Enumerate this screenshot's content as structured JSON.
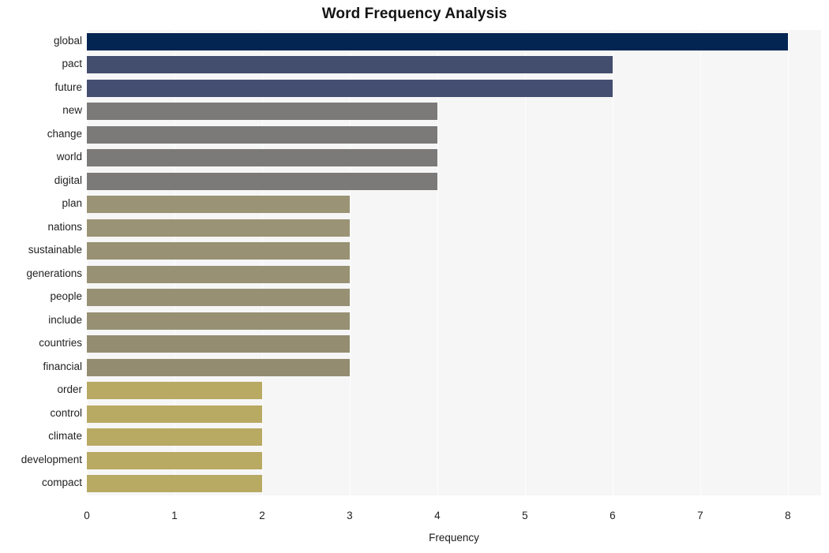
{
  "chart_data": {
    "type": "bar",
    "orientation": "horizontal",
    "title": "Word Frequency Analysis",
    "xlabel": "Frequency",
    "ylabel": "",
    "xlim": [
      0,
      8.38
    ],
    "xticks": [
      0,
      1,
      2,
      3,
      4,
      5,
      6,
      7,
      8
    ],
    "xtick_labels": [
      "0",
      "1",
      "2",
      "3",
      "4",
      "5",
      "6",
      "7",
      "8"
    ],
    "grid": "vertical",
    "legend": "none",
    "categories": [
      "global",
      "pact",
      "future",
      "new",
      "change",
      "world",
      "digital",
      "plan",
      "nations",
      "sustainable",
      "generations",
      "people",
      "include",
      "countries",
      "financial",
      "order",
      "control",
      "climate",
      "development",
      "compact"
    ],
    "values": [
      8,
      6,
      6,
      4,
      4,
      4,
      4,
      3,
      3,
      3,
      3,
      3,
      3,
      3,
      3,
      2,
      2,
      2,
      2,
      2
    ],
    "bar_colors": [
      "#032552",
      "#434d6d",
      "#434e70",
      "#7b7a78",
      "#7b7a78",
      "#7b7a78",
      "#7b7a78",
      "#9a9375",
      "#9a9375",
      "#989173",
      "#989173",
      "#979073",
      "#979073",
      "#948d71",
      "#938c70",
      "#b8a963",
      "#b8a963",
      "#b8a963",
      "#b8a963",
      "#b8a963"
    ],
    "plot_background": "#f6f6f7",
    "gridline_color": "#fdfdfd",
    "figure_background": "#ffffff"
  }
}
